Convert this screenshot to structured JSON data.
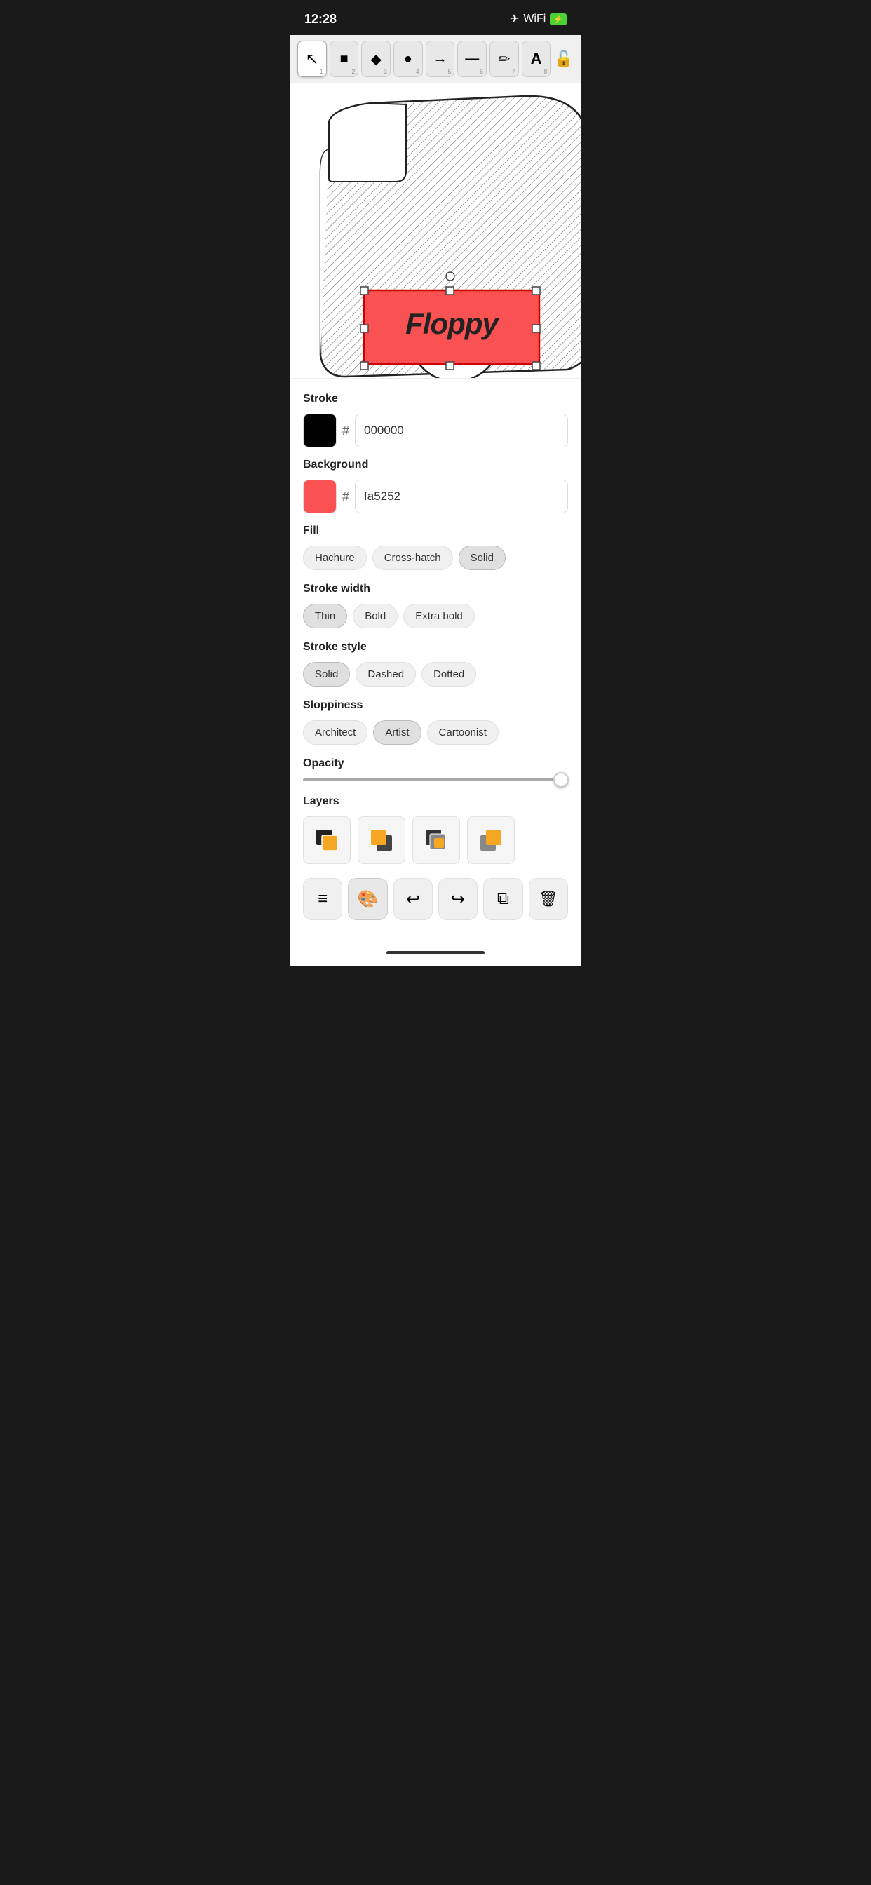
{
  "statusBar": {
    "time": "12:28",
    "icons": [
      "airplane",
      "wifi",
      "battery"
    ]
  },
  "toolbar": {
    "tools": [
      {
        "id": "select",
        "icon": "cursor",
        "num": "1",
        "unicode": "↖",
        "active": false
      },
      {
        "id": "rectangle",
        "icon": "square",
        "num": "2",
        "unicode": "■",
        "active": false
      },
      {
        "id": "diamond",
        "icon": "diamond",
        "num": "3",
        "unicode": "◆",
        "active": false
      },
      {
        "id": "circle",
        "icon": "circle",
        "num": "4",
        "unicode": "●",
        "active": false
      },
      {
        "id": "arrow",
        "icon": "arrow",
        "num": "5",
        "unicode": "→",
        "active": false
      },
      {
        "id": "line",
        "icon": "line",
        "num": "6",
        "unicode": "—",
        "active": false
      },
      {
        "id": "pencil",
        "icon": "pencil",
        "num": "7",
        "unicode": "✏",
        "active": false
      },
      {
        "id": "text",
        "icon": "text",
        "num": "8",
        "unicode": "A",
        "active": true
      }
    ],
    "lockLabel": "🔓"
  },
  "properties": {
    "stroke": {
      "label": "Stroke",
      "color": "#000000",
      "hexValue": "000000"
    },
    "background": {
      "label": "Background",
      "color": "#fa5252",
      "hexValue": "fa5252"
    },
    "fill": {
      "label": "Fill",
      "options": [
        {
          "id": "hachure",
          "label": "Hachure",
          "active": false
        },
        {
          "id": "cross-hatch",
          "label": "Cross-hatch",
          "active": false
        },
        {
          "id": "solid",
          "label": "Solid",
          "active": true
        }
      ]
    },
    "strokeWidth": {
      "label": "Stroke width",
      "options": [
        {
          "id": "thin",
          "label": "Thin",
          "active": true
        },
        {
          "id": "bold",
          "label": "Bold",
          "active": false
        },
        {
          "id": "extra-bold",
          "label": "Extra bold",
          "active": false
        }
      ]
    },
    "strokeStyle": {
      "label": "Stroke style",
      "options": [
        {
          "id": "solid",
          "label": "Solid",
          "active": true
        },
        {
          "id": "dashed",
          "label": "Dashed",
          "active": false
        },
        {
          "id": "dotted",
          "label": "Dotted",
          "active": false
        }
      ]
    },
    "sloppiness": {
      "label": "Sloppiness",
      "options": [
        {
          "id": "architect",
          "label": "Architect",
          "active": false
        },
        {
          "id": "artist",
          "label": "Artist",
          "active": true
        },
        {
          "id": "cartoonist",
          "label": "Cartoonist",
          "active": false
        }
      ]
    },
    "opacity": {
      "label": "Opacity",
      "value": 100,
      "sliderPercent": 95
    },
    "layers": {
      "label": "Layers",
      "items": [
        {
          "id": "send-backward",
          "unicode": "⬓"
        },
        {
          "id": "bring-forward",
          "unicode": "⬒"
        },
        {
          "id": "send-to-back",
          "unicode": "⬕"
        },
        {
          "id": "bring-to-front",
          "unicode": "⬔"
        }
      ]
    }
  },
  "actionBar": {
    "buttons": [
      {
        "id": "menu",
        "icon": "≡",
        "active": false
      },
      {
        "id": "style",
        "icon": "🎨",
        "active": true
      },
      {
        "id": "undo",
        "icon": "↩",
        "active": false
      },
      {
        "id": "redo",
        "icon": "↪",
        "active": false
      },
      {
        "id": "duplicate",
        "icon": "⧉",
        "active": false
      },
      {
        "id": "delete",
        "icon": "🗑",
        "active": false
      }
    ]
  }
}
